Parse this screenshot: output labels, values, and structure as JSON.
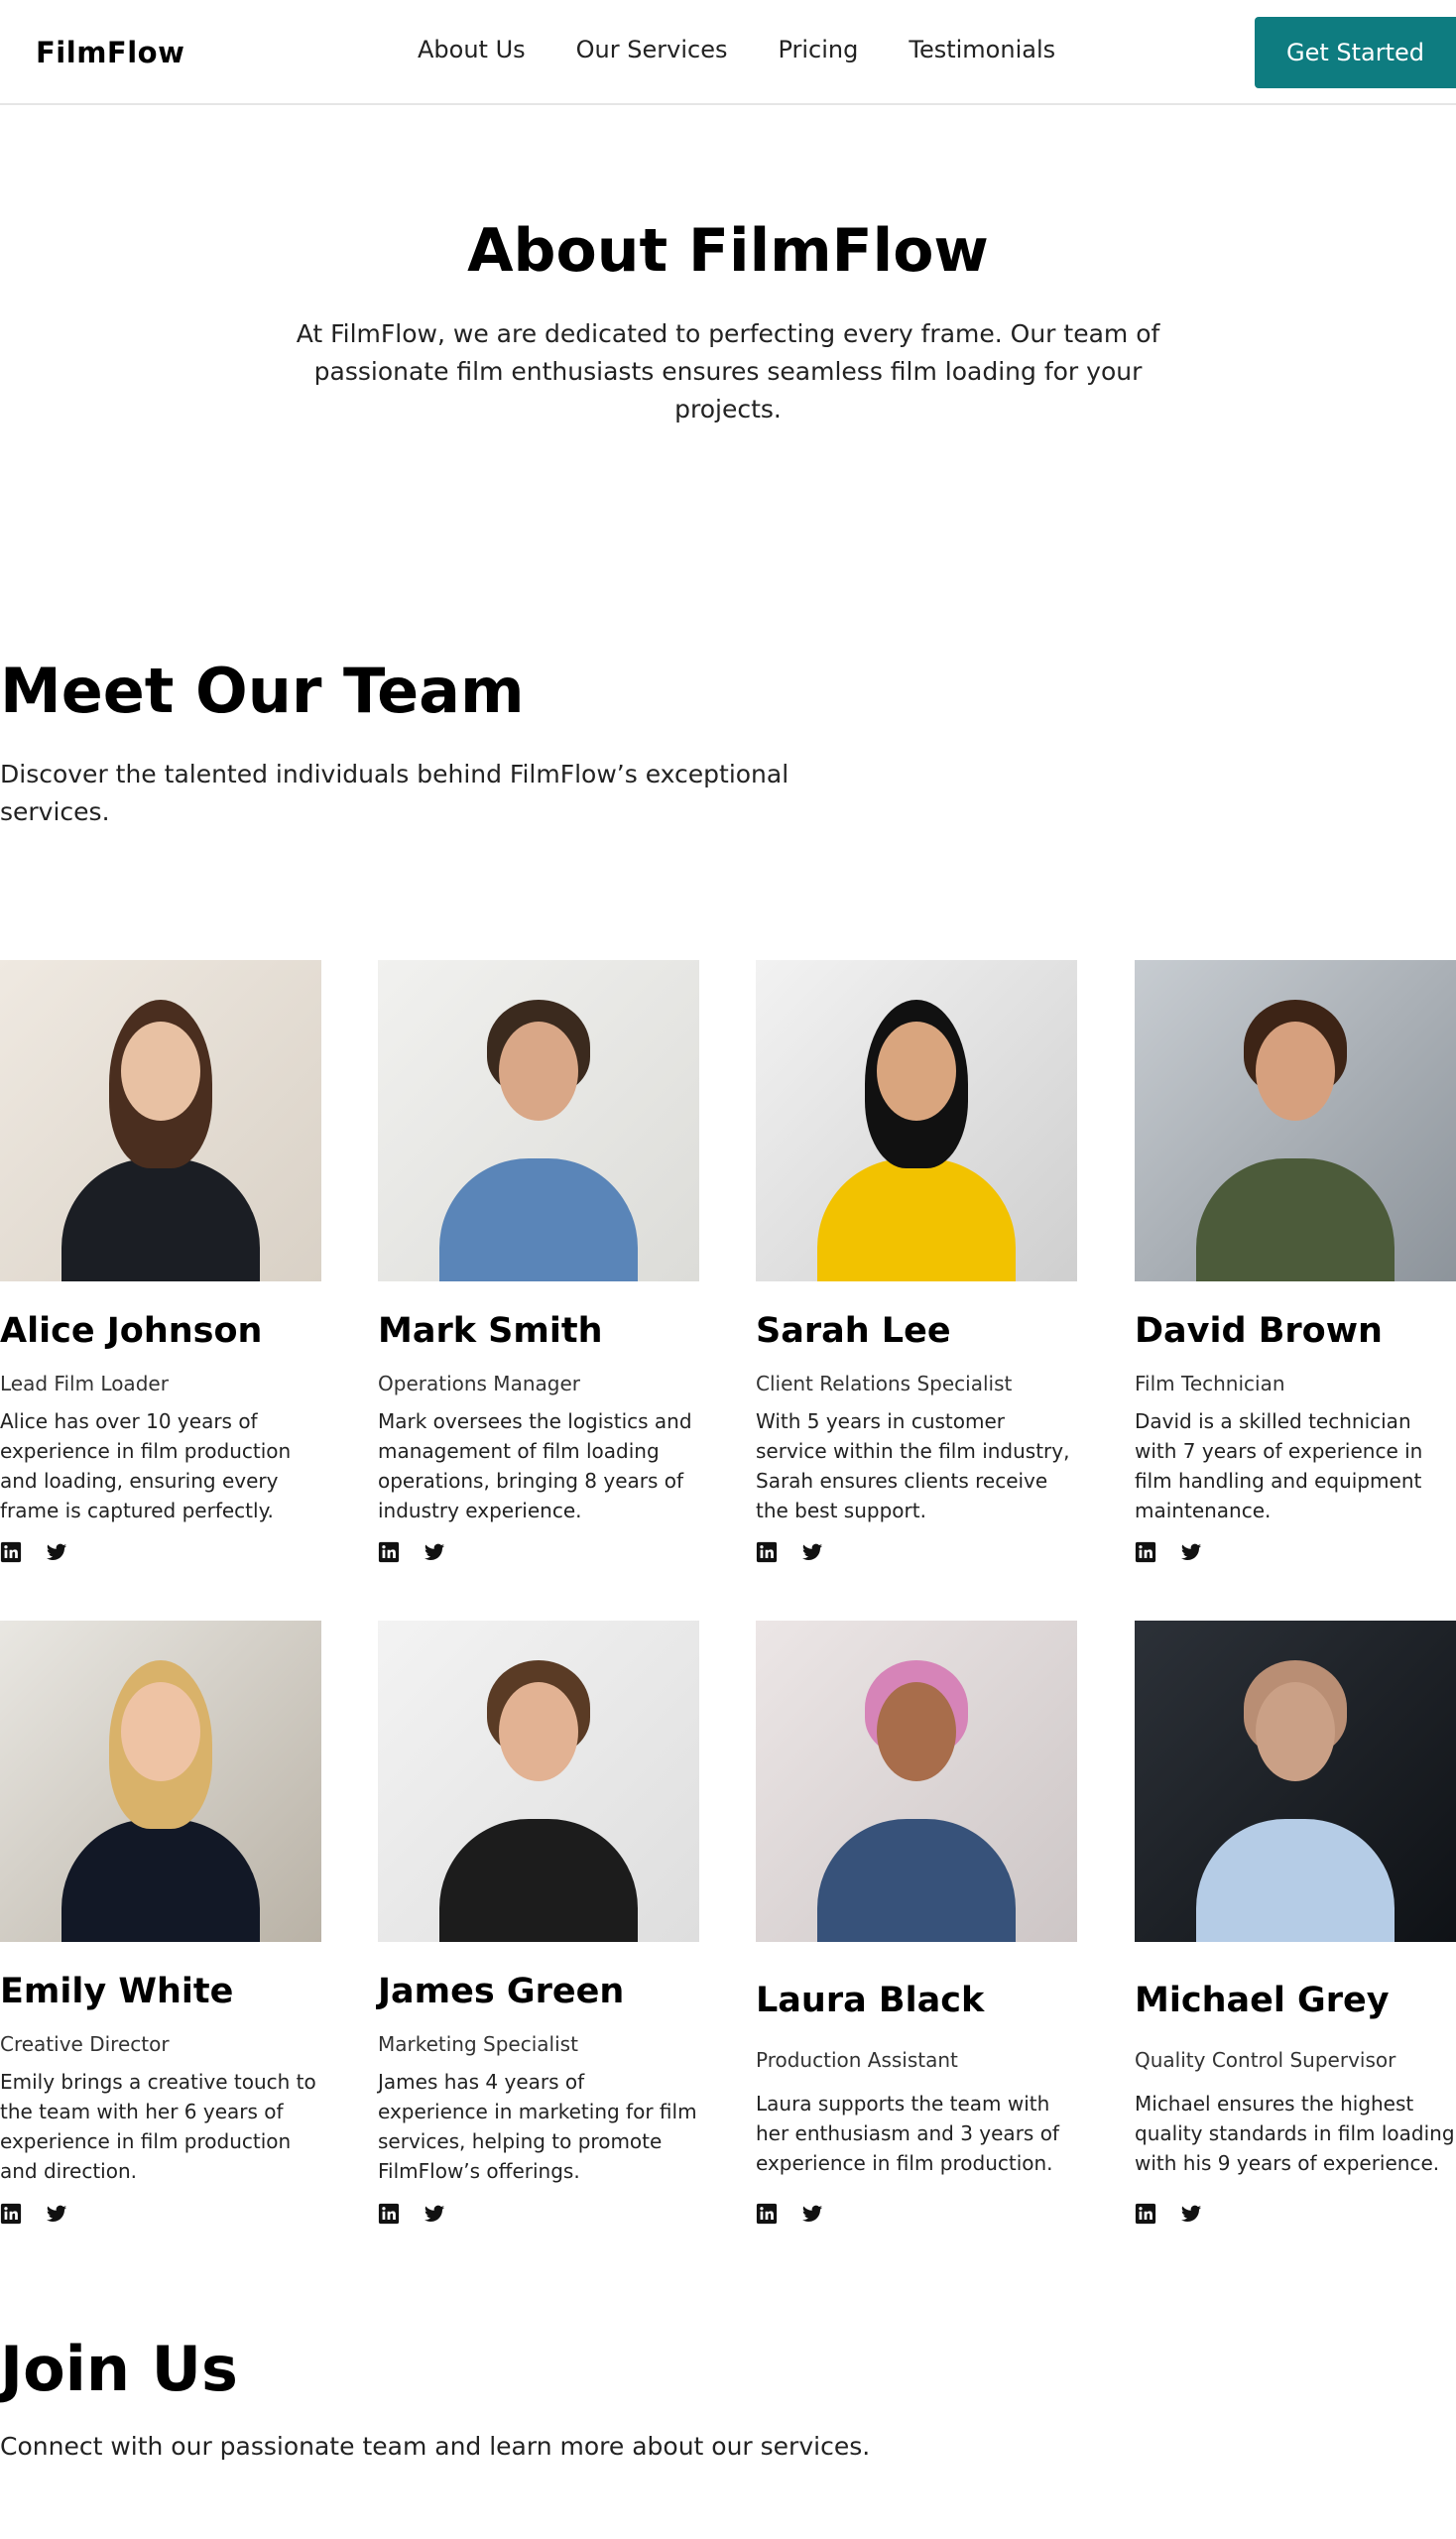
{
  "brand": {
    "name": "FilmFlow",
    "accent": "#0e7c80"
  },
  "nav": {
    "links": [
      {
        "label": "About Us"
      },
      {
        "label": "Our Services"
      },
      {
        "label": "Pricing"
      },
      {
        "label": "Testimonials"
      }
    ],
    "cta_label": "Get Started"
  },
  "hero": {
    "title": "About FilmFlow",
    "text": "At FilmFlow, we are dedicated to perfecting every frame. Our team of passionate film enthusiasts ensures seamless film loading for your projects."
  },
  "team": {
    "title": "Meet Our Team",
    "subtitle": "Discover the talented individuals behind FilmFlow’s exceptional services.",
    "members": [
      {
        "name": "Alice Johnson",
        "role": "Lead Film Loader",
        "bio": "Alice has over 10 years of experience in film production and loading, ensuring every frame is captured perfectly.",
        "socials": [
          "linkedin-icon",
          "twitter-icon"
        ]
      },
      {
        "name": "Mark Smith",
        "role": "Operations Manager",
        "bio": "Mark oversees the logistics and management of film loading operations, bringing 8 years of industry experience.",
        "socials": [
          "linkedin-icon",
          "twitter-icon"
        ]
      },
      {
        "name": "Sarah Lee",
        "role": "Client Relations Specialist",
        "bio": "With 5 years in customer service within the film industry, Sarah ensures clients receive the best support.",
        "socials": [
          "linkedin-icon",
          "twitter-icon"
        ]
      },
      {
        "name": "David Brown",
        "role": "Film Technician",
        "bio": "David is a skilled technician with 7 years of experience in film handling and equipment maintenance.",
        "socials": [
          "linkedin-icon",
          "twitter-icon"
        ]
      },
      {
        "name": "Emily White",
        "role": "Creative Director",
        "bio": "Emily brings a creative touch to the team with her 6 years of experience in film production and direction.",
        "socials": [
          "linkedin-icon",
          "twitter-icon"
        ]
      },
      {
        "name": "James Green",
        "role": "Marketing Specialist",
        "bio": "James has 4 years of experience in marketing for film services, helping to promote FilmFlow’s offerings.",
        "socials": [
          "linkedin-icon",
          "twitter-icon"
        ]
      },
      {
        "name": "Laura Black",
        "role": "Production Assistant",
        "bio": "Laura supports the team with her enthusiasm and 3 years of experience in film production.",
        "socials": [
          "linkedin-icon",
          "twitter-icon"
        ]
      },
      {
        "name": "Michael Grey",
        "role": "Quality Control Supervisor",
        "bio": "Michael ensures the highest quality standards in film loading with his 9 years of experience.",
        "socials": [
          "linkedin-icon",
          "twitter-icon"
        ]
      }
    ]
  },
  "join": {
    "title": "Join Us",
    "text": "Connect with our passionate team and learn more about our services."
  }
}
